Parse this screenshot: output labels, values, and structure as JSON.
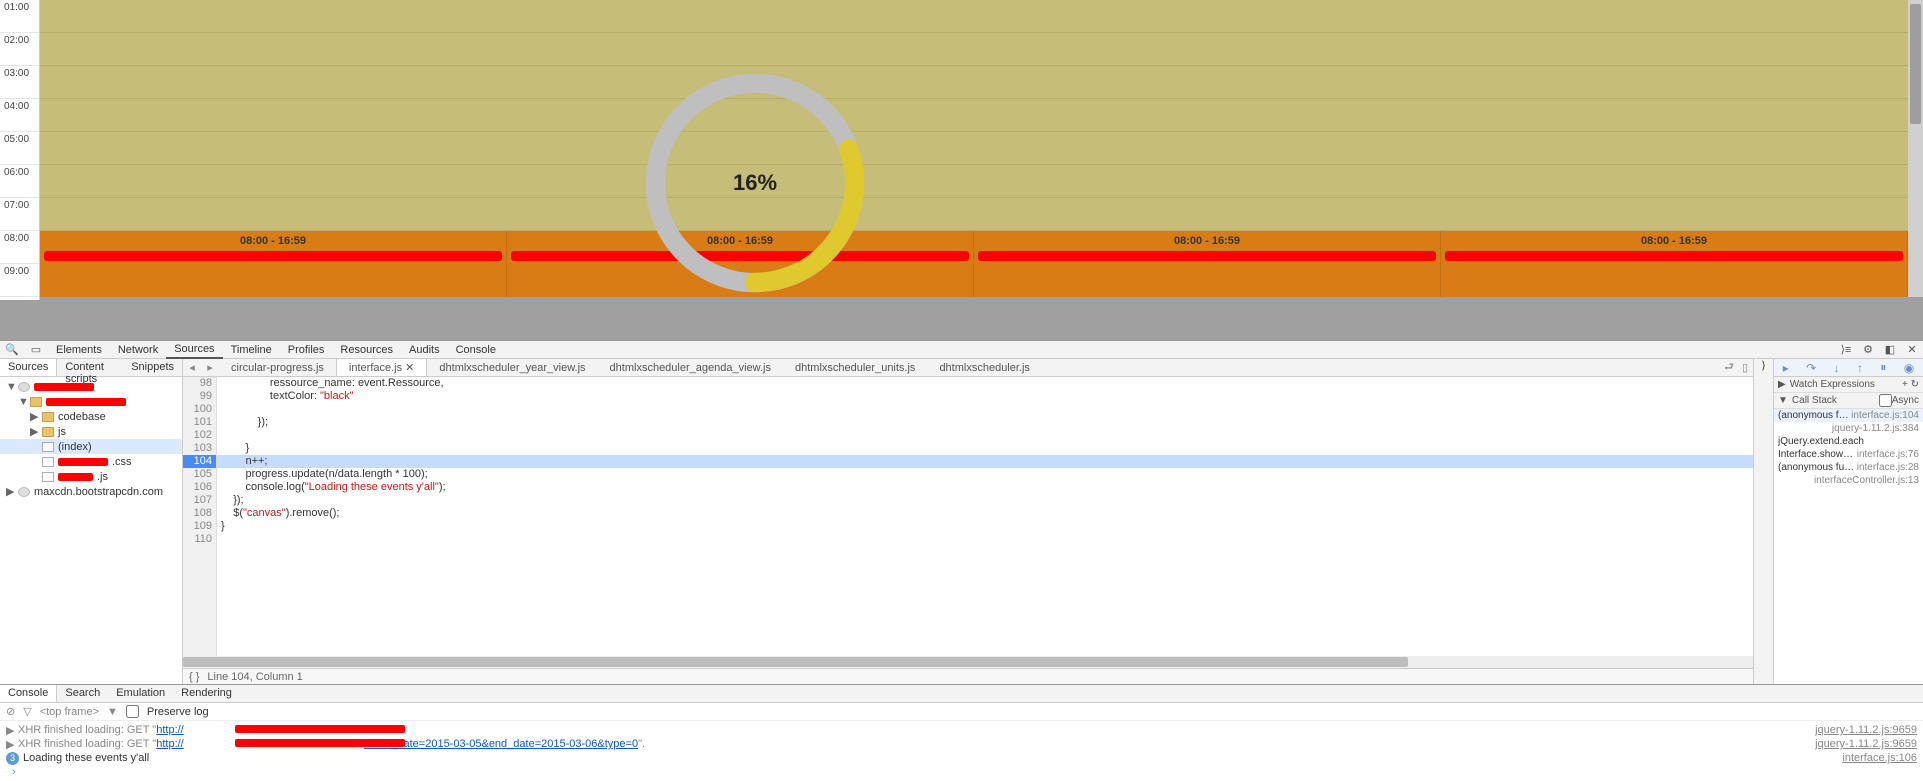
{
  "scheduler": {
    "hours": [
      "01:00",
      "02:00",
      "03:00",
      "04:00",
      "05:00",
      "06:00",
      "07:00",
      "08:00",
      "09:00"
    ],
    "event_time_label": "08:00 - 16:59",
    "progress_pct": "16%"
  },
  "devtools": {
    "main_tabs": [
      "Elements",
      "Network",
      "Sources",
      "Timeline",
      "Profiles",
      "Resources",
      "Audits",
      "Console"
    ],
    "main_tab_selected": "Sources",
    "nav_tabs": [
      "Sources",
      "Content scripts",
      "Snippets"
    ],
    "nav_tab_selected": "Sources",
    "tree": {
      "codebase": "codebase",
      "js": "js",
      "index": "(index)",
      "maxcdn": "maxcdn.bootstrapcdn.com"
    },
    "file_tabs": [
      "circular-progress.js",
      "interface.js",
      "dhtmlxscheduler_year_view.js",
      "dhtmlxscheduler_agenda_view.js",
      "dhtmlxscheduler_units.js",
      "dhtmlxscheduler.js"
    ],
    "file_tab_active": "interface.js",
    "gutter": [
      "98",
      "99",
      "100",
      "101",
      "102",
      "103",
      "104",
      "105",
      "106",
      "107",
      "108",
      "109",
      "110"
    ],
    "code_lines": {
      "l98": "                ressource_name: event.Ressource,",
      "l99a": "                textColor: ",
      "l99b": "\"black\"",
      "l100": "",
      "l101": "            });",
      "l102": "",
      "l103": "        }",
      "l104": "        n++;",
      "l105": "        progress.update(n/data.length * 100);",
      "l106a": "        console.log(",
      "l106b": "\"Loading these events y'all\"",
      "l106c": ");",
      "l107": "    });",
      "l108a": "    $(",
      "l108b": "\"canvas\"",
      "l108c": ").remove();",
      "l109": "}",
      "l110": ""
    },
    "status_line": "Line 104, Column 1",
    "watch_hdr": "Watch Expressions",
    "callstack_hdr": "Call Stack",
    "async_label": "Async",
    "callstack": [
      {
        "fn": "(anonymous function)",
        "loc": "interface.js:104"
      },
      {
        "fn": "",
        "loc": "jquery-1.11.2.js:384"
      },
      {
        "fn": "jQuery.extend.each",
        "loc": ""
      },
      {
        "fn": "Interface.showData",
        "loc": "interface.js:76"
      },
      {
        "fn": "(anonymous function)",
        "loc": "interface.js:28"
      },
      {
        "fn": "",
        "loc": "interfaceController.js:13"
      }
    ],
    "drawer_tabs": [
      "Console",
      "Search",
      "Emulation",
      "Rendering"
    ],
    "drawer_tab_selected": "Console",
    "top_frame": "<top frame>",
    "preserve_log": "Preserve log",
    "console": {
      "xhr_prefix": "XHR finished loading: GET \"",
      "xhr1_url": "http://",
      "xhr1_end": "\".",
      "xhr2_url": "http://",
      "xhr2_tail": "?start_date=2015-03-05&end_date=2015-03-06&type=0",
      "xhr2_end": "\".",
      "xhr_src": "jquery-1.11.2.js:9659",
      "msg_badge": "3",
      "msg": "Loading these events y'all",
      "msg_src": "interface.js:106"
    }
  }
}
